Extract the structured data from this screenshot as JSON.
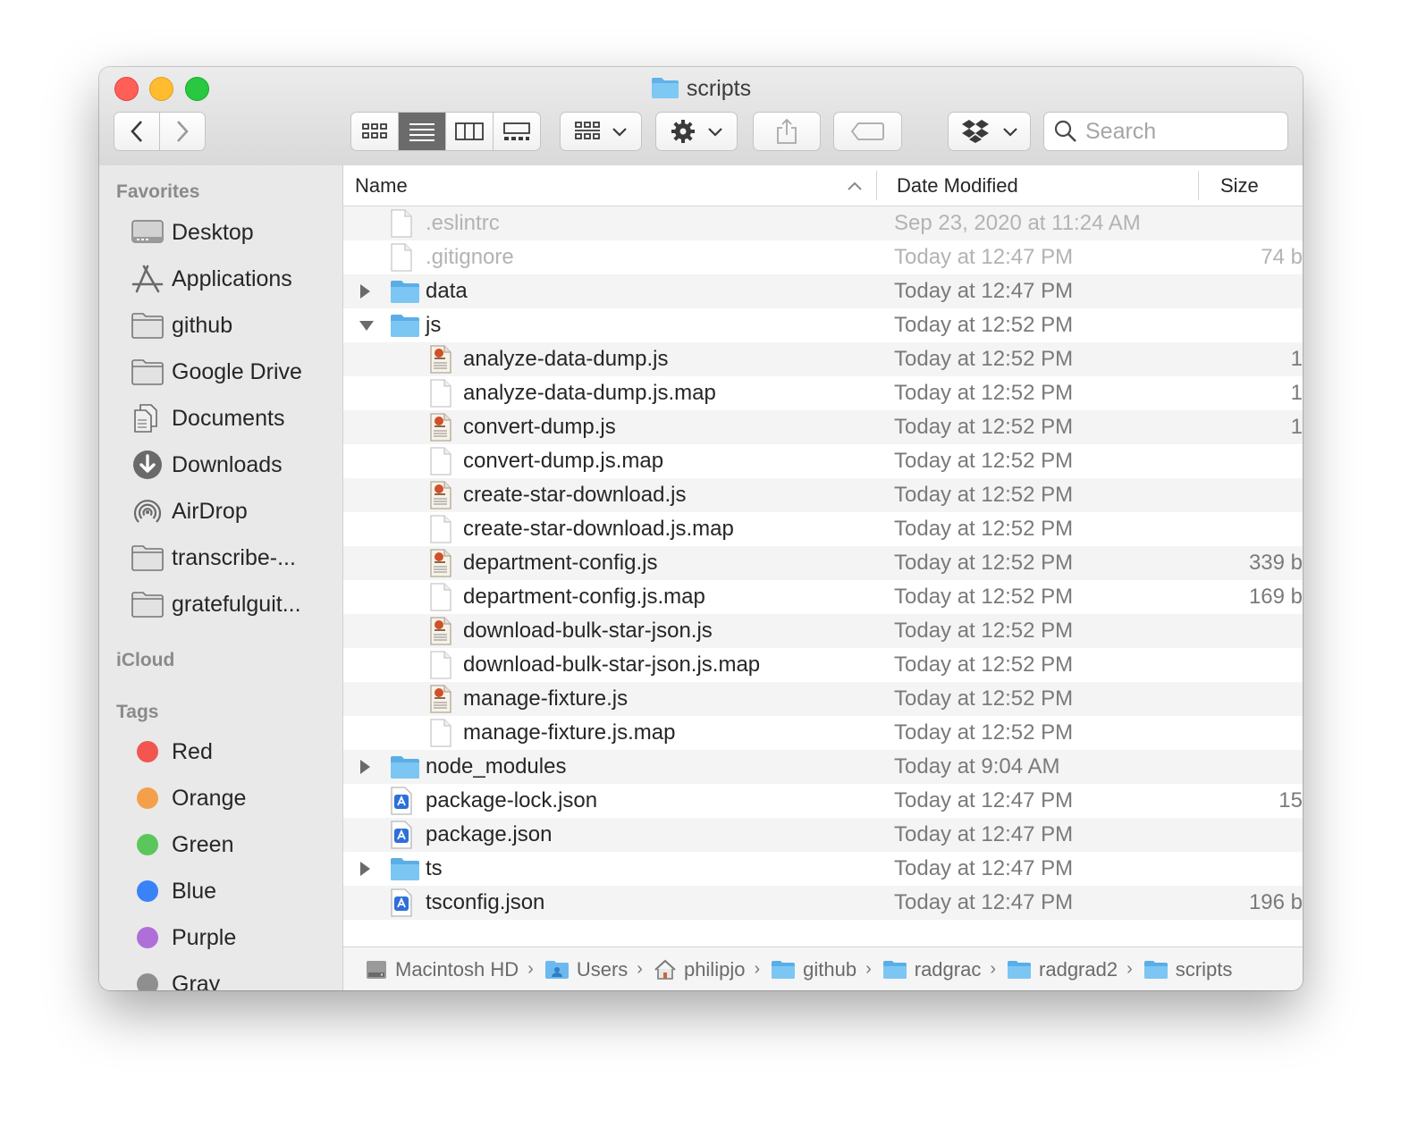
{
  "window": {
    "title": "scripts"
  },
  "toolbar": {
    "back_icon": "chevron-left-icon",
    "forward_icon": "chevron-right-icon",
    "view_modes": [
      "icon-view",
      "list-view",
      "column-view",
      "gallery-view"
    ],
    "active_view": "list-view",
    "search": {
      "placeholder": "Search",
      "value": ""
    }
  },
  "sidebar": {
    "favorites_label": "Favorites",
    "favorites": [
      {
        "label": "Desktop",
        "icon": "desktop-icon"
      },
      {
        "label": "Applications",
        "icon": "applications-icon"
      },
      {
        "label": "github",
        "icon": "folder-icon"
      },
      {
        "label": "Google Drive",
        "icon": "folder-icon"
      },
      {
        "label": "Documents",
        "icon": "documents-icon"
      },
      {
        "label": "Downloads",
        "icon": "downloads-icon"
      },
      {
        "label": "AirDrop",
        "icon": "airdrop-icon"
      },
      {
        "label": "transcribe-...",
        "icon": "folder-icon"
      },
      {
        "label": "gratefulguit...",
        "icon": "folder-icon"
      }
    ],
    "icloud_label": "iCloud",
    "tags_label": "Tags",
    "tags": [
      {
        "label": "Red",
        "color": "#f2564f"
      },
      {
        "label": "Orange",
        "color": "#f4a04a"
      },
      {
        "label": "Green",
        "color": "#5bc65b"
      },
      {
        "label": "Blue",
        "color": "#3a82f7"
      },
      {
        "label": "Purple",
        "color": "#b06ed8"
      },
      {
        "label": "Gray",
        "color": "#8f8f8f"
      }
    ]
  },
  "columns": {
    "name": "Name",
    "date": "Date Modified",
    "size": "Size"
  },
  "files": [
    {
      "name": ".eslintrc",
      "date": "Sep 23, 2020 at 11:24 AM",
      "size": "",
      "kind": "doc",
      "indent": 0,
      "dim": true,
      "disclosure": ""
    },
    {
      "name": ".gitignore",
      "date": "Today at 12:47 PM",
      "size": "74 b",
      "kind": "doc",
      "indent": 0,
      "dim": true,
      "disclosure": ""
    },
    {
      "name": "data",
      "date": "Today at 12:47 PM",
      "size": "",
      "kind": "folder",
      "indent": 0,
      "dim": false,
      "disclosure": "collapsed"
    },
    {
      "name": "js",
      "date": "Today at 12:52 PM",
      "size": "",
      "kind": "folder",
      "indent": 0,
      "dim": false,
      "disclosure": "expanded"
    },
    {
      "name": "analyze-data-dump.js",
      "date": "Today at 12:52 PM",
      "size": "1",
      "kind": "js",
      "indent": 1,
      "dim": false,
      "disclosure": ""
    },
    {
      "name": "analyze-data-dump.js.map",
      "date": "Today at 12:52 PM",
      "size": "1",
      "kind": "doc",
      "indent": 1,
      "dim": false,
      "disclosure": ""
    },
    {
      "name": "convert-dump.js",
      "date": "Today at 12:52 PM",
      "size": "1",
      "kind": "js",
      "indent": 1,
      "dim": false,
      "disclosure": ""
    },
    {
      "name": "convert-dump.js.map",
      "date": "Today at 12:52 PM",
      "size": "",
      "kind": "doc",
      "indent": 1,
      "dim": false,
      "disclosure": ""
    },
    {
      "name": "create-star-download.js",
      "date": "Today at 12:52 PM",
      "size": "",
      "kind": "js",
      "indent": 1,
      "dim": false,
      "disclosure": ""
    },
    {
      "name": "create-star-download.js.map",
      "date": "Today at 12:52 PM",
      "size": "",
      "kind": "doc",
      "indent": 1,
      "dim": false,
      "disclosure": ""
    },
    {
      "name": "department-config.js",
      "date": "Today at 12:52 PM",
      "size": "339 b",
      "kind": "js",
      "indent": 1,
      "dim": false,
      "disclosure": ""
    },
    {
      "name": "department-config.js.map",
      "date": "Today at 12:52 PM",
      "size": "169 b",
      "kind": "doc",
      "indent": 1,
      "dim": false,
      "disclosure": ""
    },
    {
      "name": "download-bulk-star-json.js",
      "date": "Today at 12:52 PM",
      "size": "",
      "kind": "js",
      "indent": 1,
      "dim": false,
      "disclosure": ""
    },
    {
      "name": "download-bulk-star-json.js.map",
      "date": "Today at 12:52 PM",
      "size": "",
      "kind": "doc",
      "indent": 1,
      "dim": false,
      "disclosure": ""
    },
    {
      "name": "manage-fixture.js",
      "date": "Today at 12:52 PM",
      "size": "",
      "kind": "js",
      "indent": 1,
      "dim": false,
      "disclosure": ""
    },
    {
      "name": "manage-fixture.js.map",
      "date": "Today at 12:52 PM",
      "size": "",
      "kind": "doc",
      "indent": 1,
      "dim": false,
      "disclosure": ""
    },
    {
      "name": "node_modules",
      "date": "Today at 9:04 AM",
      "size": "",
      "kind": "folder",
      "indent": 0,
      "dim": false,
      "disclosure": "collapsed"
    },
    {
      "name": "package-lock.json",
      "date": "Today at 12:47 PM",
      "size": "15",
      "kind": "json",
      "indent": 0,
      "dim": false,
      "disclosure": ""
    },
    {
      "name": "package.json",
      "date": "Today at 12:47 PM",
      "size": "",
      "kind": "json",
      "indent": 0,
      "dim": false,
      "disclosure": ""
    },
    {
      "name": "ts",
      "date": "Today at 12:47 PM",
      "size": "",
      "kind": "folder",
      "indent": 0,
      "dim": false,
      "disclosure": "collapsed"
    },
    {
      "name": "tsconfig.json",
      "date": "Today at 12:47 PM",
      "size": "196 b",
      "kind": "json",
      "indent": 0,
      "dim": false,
      "disclosure": ""
    }
  ],
  "path": [
    {
      "label": "Macintosh HD",
      "icon": "hard-drive-icon"
    },
    {
      "label": "Users",
      "icon": "users-folder-icon"
    },
    {
      "label": "philipjo",
      "icon": "home-icon"
    },
    {
      "label": "github",
      "icon": "folder-icon"
    },
    {
      "label": "radgrac",
      "icon": "folder-icon"
    },
    {
      "label": "radgrad2",
      "icon": "folder-icon"
    },
    {
      "label": "scripts",
      "icon": "folder-icon"
    }
  ]
}
